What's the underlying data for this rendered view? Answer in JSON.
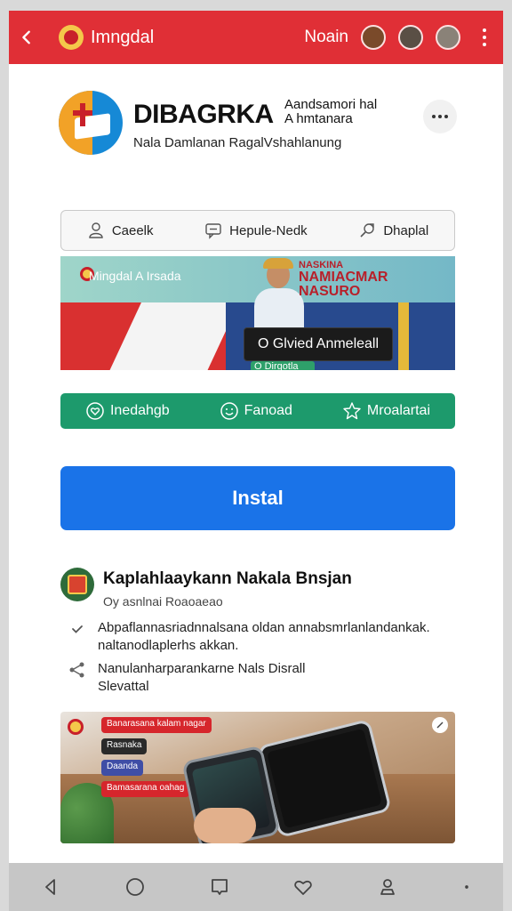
{
  "topbar": {
    "title": "Imngdal",
    "login": "Noain",
    "icons": [
      "back-arrow-icon",
      "flag-icon",
      "avatar-icon",
      "more-vertical-icon"
    ]
  },
  "app": {
    "name": "DIBAGRKA",
    "side_line1": "Aandsamori hal",
    "side_line2": "A hmtanara",
    "subtitle": "Nala Damlanan RagalVshahlanung",
    "more_icon": "more-horizontal-icon"
  },
  "pills": [
    {
      "label": "Caeelk",
      "icon": "user-icon"
    },
    {
      "label": "Hepule-Nedk",
      "icon": "chat-icon"
    },
    {
      "label": "Dhaplal",
      "icon": "share-icon"
    }
  ],
  "banner": {
    "caption": "Mingdal A Irsada",
    "headline_small": "NASKINA",
    "headline_line1": "NAMIACMAR",
    "headline_line2": "NASURO",
    "box_text": "O Glvied Anmeleall",
    "sub_text": "O Dirgotla"
  },
  "greenbar": [
    {
      "label": "Inedahgb",
      "icon": "heart-icon"
    },
    {
      "label": "Fanoad",
      "icon": "smile-icon"
    },
    {
      "label": "Mroalartai",
      "icon": "star-icon"
    }
  ],
  "install": {
    "label": "Instal"
  },
  "publisher": {
    "name": "Kaplahlaaykann Nakala Bnsjan",
    "subtitle": "Oy asnlnai Roaoaeao"
  },
  "features": [
    {
      "icon": "check-icon",
      "line1": "Abpaflannasriadnnalsana oldan annabsmrlanlandankak.",
      "line2": "naltanodlaplerhs akkan."
    },
    {
      "icon": "share-nodes-icon",
      "line1": "Nanulanharparankarne Nals Disrall",
      "line2": "Slevattal"
    }
  ],
  "photo": {
    "tags": [
      {
        "text": "Banarasana kalam nagar",
        "color": "#d6262c"
      },
      {
        "text": "Rasnaka",
        "color": "#2a2a2a"
      },
      {
        "text": "Daanda",
        "color": "#3f4ea6"
      },
      {
        "text": "Bamasarana oahag",
        "color": "#d6262c"
      }
    ],
    "expand_icon": "expand-icon"
  },
  "navbar": [
    "nav-back-icon",
    "nav-home-icon",
    "nav-recents-icon",
    "nav-favorite-icon",
    "nav-profile-icon"
  ],
  "colors": {
    "red": "#e02f36",
    "blue": "#1a73e8",
    "green": "#1d9a6c"
  }
}
